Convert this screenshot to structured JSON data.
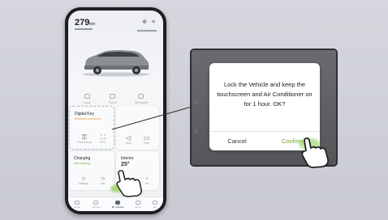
{
  "phone": {
    "range_value": "279",
    "range_unit": "km",
    "top_icons": "⊕ ≡",
    "quick_actions": [
      "Lock",
      "Trunk",
      "Windows"
    ],
    "digital_key": {
      "title": "Digital Key",
      "subtitle": "Bluetooth connected",
      "items": [
        "Phone Key",
        "NFC"
      ]
    },
    "right_card": {
      "items": [
        "Vent",
        "Fan"
      ]
    },
    "charging": {
      "title": "Charging",
      "subtitle": "Not charging",
      "items": [
        "Settings",
        "Info"
      ]
    },
    "climate": {
      "title": "Interior",
      "value": "25°",
      "items": [
        "On",
        "Off"
      ]
    },
    "nav": [
      "Home",
      "Service",
      "My Vehicle",
      "Shop",
      "Me"
    ]
  },
  "dialog": {
    "message": "Lock the Vehicle and keep the touchscreen and Air Conditioner on for 1 hour. OK?",
    "cancel_label": "Cancel",
    "confirm_label": "Confirm"
  },
  "colors": {
    "confirm_green": "#6aa431",
    "tap_glow": "#84c83c"
  }
}
